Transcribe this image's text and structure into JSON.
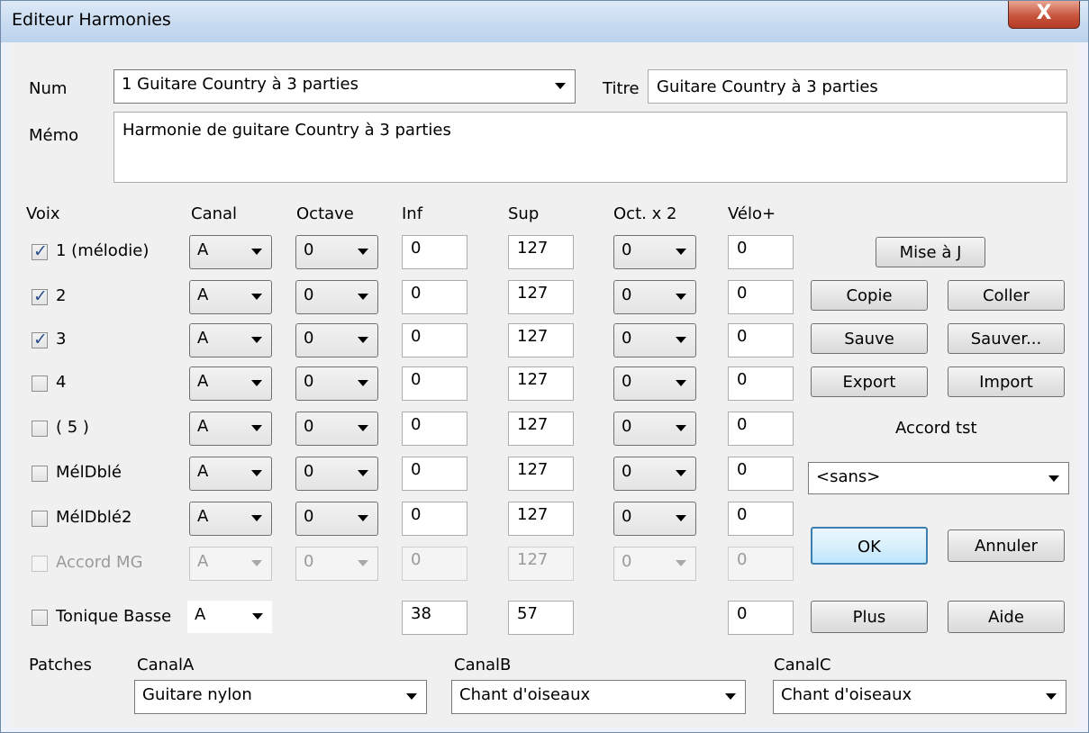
{
  "window": {
    "title": "Editeur Harmonies",
    "close_glyph": "X"
  },
  "num": {
    "label": "Num",
    "value": "1 Guitare Country à 3 parties"
  },
  "titre": {
    "label": "Titre",
    "value": "Guitare Country à 3 parties"
  },
  "memo": {
    "label": "Mémo",
    "value": "Harmonie de guitare Country à 3 parties"
  },
  "headers": {
    "voix": "Voix",
    "canal": "Canal",
    "octave": "Octave",
    "inf": "Inf",
    "sup": "Sup",
    "oct2": "Oct. x 2",
    "velo": "Vélo+"
  },
  "rows": [
    {
      "name": "1 (mélodie)",
      "checked": true,
      "enabled": true,
      "canal": "A",
      "octave": "0",
      "inf": "0",
      "sup": "127",
      "oct2": "0",
      "velo": "0"
    },
    {
      "name": "2",
      "checked": true,
      "enabled": true,
      "canal": "A",
      "octave": "0",
      "inf": "0",
      "sup": "127",
      "oct2": "0",
      "velo": "0"
    },
    {
      "name": "3",
      "checked": true,
      "enabled": true,
      "canal": "A",
      "octave": "0",
      "inf": "0",
      "sup": "127",
      "oct2": "0",
      "velo": "0"
    },
    {
      "name": "4",
      "checked": false,
      "enabled": true,
      "canal": "A",
      "octave": "0",
      "inf": "0",
      "sup": "127",
      "oct2": "0",
      "velo": "0"
    },
    {
      "name": "( 5 )",
      "checked": false,
      "enabled": true,
      "canal": "A",
      "octave": "0",
      "inf": "0",
      "sup": "127",
      "oct2": "0",
      "velo": "0"
    },
    {
      "name": "MélDblé",
      "checked": false,
      "enabled": true,
      "canal": "A",
      "octave": "0",
      "inf": "0",
      "sup": "127",
      "oct2": "0",
      "velo": "0"
    },
    {
      "name": "MélDblé2",
      "checked": false,
      "enabled": true,
      "canal": "A",
      "octave": "0",
      "inf": "0",
      "sup": "127",
      "oct2": "0",
      "velo": "0"
    },
    {
      "name": "Accord MG",
      "checked": false,
      "enabled": false,
      "canal": "A",
      "octave": "0",
      "inf": "0",
      "sup": "127",
      "oct2": "0",
      "velo": "0"
    }
  ],
  "tonique": {
    "name": "Tonique Basse",
    "checked": false,
    "canal": "A",
    "inf": "38",
    "sup": "57",
    "velo": "0"
  },
  "buttons": {
    "mise_a_j": "Mise à J",
    "copie": "Copie",
    "coller": "Coller",
    "sauve": "Sauve",
    "sauver": "Sauver...",
    "export": "Export",
    "import": "Import",
    "ok": "OK",
    "annuler": "Annuler",
    "plus": "Plus",
    "aide": "Aide"
  },
  "accord_tst": {
    "label": "Accord tst",
    "value": "<sans>"
  },
  "patches": {
    "label": "Patches",
    "canalA": {
      "label": "CanalA",
      "value": "Guitare nylon"
    },
    "canalB": {
      "label": "CanalB",
      "value": "Chant d'oiseaux"
    },
    "canalC": {
      "label": "CanalC",
      "value": "Chant d'oiseaux"
    }
  },
  "icons": [
    "close-icon",
    "dropdown-arrow-icon",
    "checkbox-check-icon"
  ]
}
